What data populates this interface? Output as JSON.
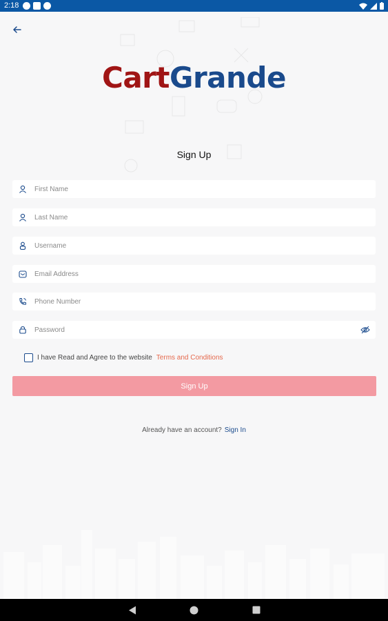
{
  "status_bar": {
    "time": "2:18"
  },
  "app": {
    "logo_part1": "Cart",
    "logo_part2": "Grande"
  },
  "page": {
    "title": "Sign Up"
  },
  "form": {
    "first_name": {
      "placeholder": "First Name",
      "icon": "person-icon"
    },
    "last_name": {
      "placeholder": "Last Name",
      "icon": "person-icon"
    },
    "username": {
      "placeholder": "Username",
      "icon": "user-badge-icon"
    },
    "email": {
      "placeholder": "Email Address",
      "icon": "mail-icon"
    },
    "phone": {
      "placeholder": "Phone Number",
      "icon": "phone-icon"
    },
    "password": {
      "placeholder": "Password",
      "icon": "lock-icon",
      "toggle_icon": "eye-off-icon"
    }
  },
  "agreement": {
    "text": "I have Read and Agree to the website",
    "link": "Terms and Conditions",
    "checked": false
  },
  "actions": {
    "signup_label": "Sign Up"
  },
  "footer": {
    "prompt": "Already have an account?",
    "signin_label": "Sign In"
  },
  "colors": {
    "status_bar": "#0b58a5",
    "brand_red": "#a01515",
    "brand_blue": "#1a4a8c",
    "button_pink": "#f39aa2",
    "link_orange": "#e5684c"
  }
}
